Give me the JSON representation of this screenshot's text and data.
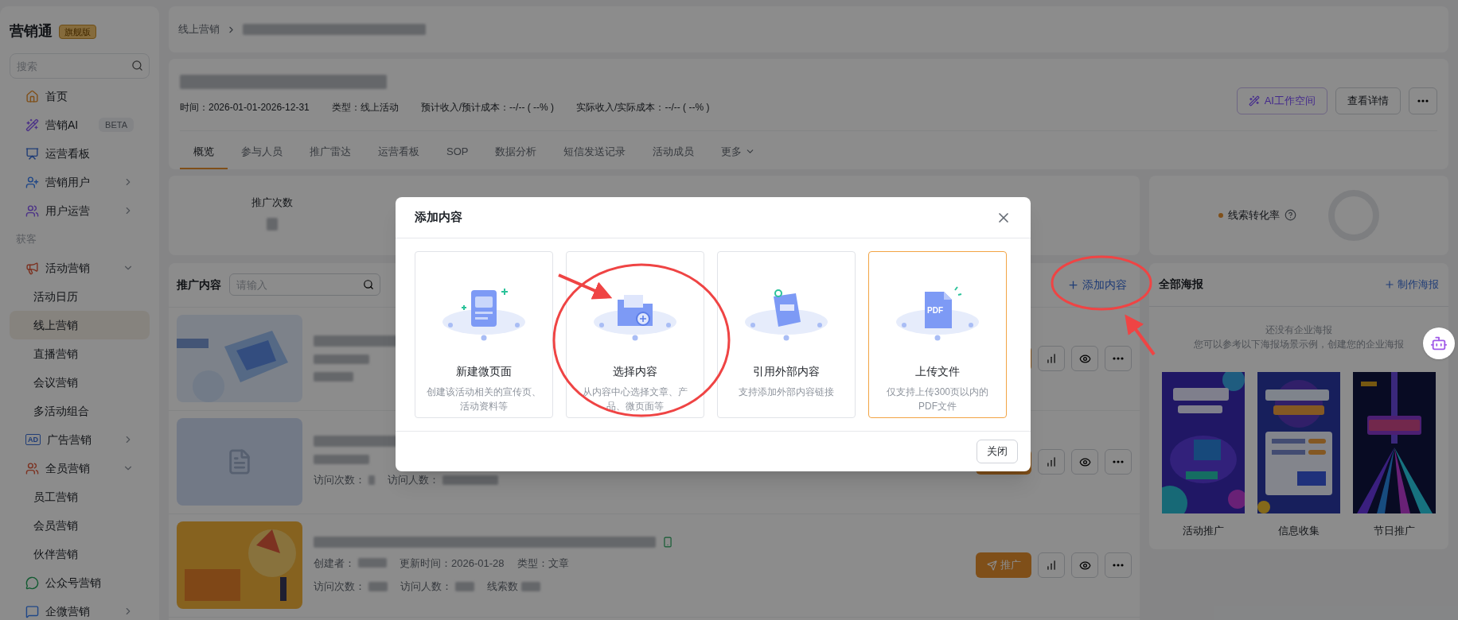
{
  "sidebar": {
    "brand": "营销通",
    "edition": "旗舰版",
    "search": {
      "placeholder": "搜索"
    },
    "items": [
      {
        "kind": "item",
        "label": "首页",
        "selected": false
      },
      {
        "kind": "item",
        "label": "营销AI",
        "badge": "BETA",
        "selected": false
      },
      {
        "kind": "item",
        "label": "运营看板",
        "selected": false
      },
      {
        "kind": "item",
        "label": "营销用户",
        "expanded": false,
        "selected": false
      },
      {
        "kind": "item",
        "label": "用户运营",
        "expanded": false,
        "selected": false
      },
      {
        "kind": "section",
        "label": "获客"
      },
      {
        "kind": "item",
        "label": "活动营销",
        "expanded": true,
        "selected": false,
        "children": [
          {
            "label": "活动日历",
            "selected": false
          },
          {
            "label": "线上营销",
            "selected": true
          },
          {
            "label": "直播营销",
            "selected": false
          },
          {
            "label": "会议营销",
            "selected": false
          },
          {
            "label": "多活动组合",
            "selected": false
          }
        ]
      },
      {
        "kind": "item",
        "icon_text": "AD",
        "label": "广告营销",
        "expanded": false,
        "selected": false
      },
      {
        "kind": "item",
        "label": "全员营销",
        "expanded": true,
        "selected": false,
        "children": [
          {
            "label": "员工营销",
            "selected": false
          },
          {
            "label": "会员营销",
            "selected": false
          },
          {
            "label": "伙伴营销",
            "selected": false
          }
        ]
      },
      {
        "kind": "item",
        "label": "公众号营销",
        "selected": false
      },
      {
        "kind": "item",
        "label": "企微营销",
        "expanded": false,
        "selected": false
      }
    ]
  },
  "breadcrumb": {
    "items": [
      "线上营销"
    ]
  },
  "activity": {
    "meta": [
      "时间：2026-01-01-2026-12-31",
      "类型：线上活动",
      "预计收入/预计成本：--/-- ( --% )",
      "实际收入/实际成本：--/-- ( --% )"
    ],
    "buttons": [
      {
        "kind": "ai",
        "label": "AI工作空间"
      },
      {
        "kind": "plain",
        "label": "查看详情"
      },
      {
        "kind": "more"
      }
    ],
    "tabs": [
      {
        "label": "概览",
        "selected": true
      },
      {
        "label": "参与人员",
        "selected": false
      },
      {
        "label": "推广雷达",
        "selected": false
      },
      {
        "label": "运营看板",
        "selected": false
      },
      {
        "label": "SOP",
        "selected": false
      },
      {
        "label": "数据分析",
        "selected": false
      },
      {
        "label": "短信发送记录",
        "selected": false
      },
      {
        "label": "活动成员",
        "selected": false
      },
      {
        "label": "更多",
        "selected": false,
        "dropdown": true
      }
    ]
  },
  "stats": {
    "items": [
      {
        "label": "推广次数"
      }
    ],
    "conversion": {
      "label": "线索转化率"
    }
  },
  "promo": {
    "title": "推广内容",
    "search": {
      "placeholder": "请输入"
    },
    "add_button": "添加内容",
    "rows": [
      {
        "kind": "picture",
        "fields": []
      },
      {
        "kind": "document",
        "fields": [
          "访问次数：",
          "访问人数："
        ]
      },
      {
        "kind": "picture",
        "mobile": true,
        "fields": [
          "创建者：",
          "更新时间：2026-01-28",
          "类型：文章",
          "访问次数：",
          "访问人数：",
          "线索数"
        ],
        "promote_label": "推广"
      }
    ]
  },
  "posters": {
    "title": "全部海报",
    "action": "制作海报",
    "empty": [
      "还没有企业海报",
      "您可以参考以下海报场景示例，创建您的企业海报"
    ],
    "items": [
      {
        "label": "活动推广",
        "kind": "picture"
      },
      {
        "label": "信息收集",
        "kind": "picture"
      },
      {
        "label": "节日推广",
        "kind": "picture"
      }
    ]
  },
  "modal": {
    "title": "添加内容",
    "options": [
      {
        "kind": "page",
        "title": "新建微页面",
        "desc": "创建该活动相关的宣传页、活动资料等",
        "highlighted": false
      },
      {
        "kind": "folder",
        "title": "选择内容",
        "desc": "从内容中心选择文章、产品、微页面等",
        "highlighted": false
      },
      {
        "kind": "link",
        "title": "引用外部内容",
        "desc": "支持添加外部内容链接",
        "highlighted": false
      },
      {
        "kind": "pdf",
        "icon_text": "PDF",
        "title": "上传文件",
        "desc": "仅支持上传300页以内的PDF文件",
        "highlighted": true
      }
    ],
    "close_button": "关闭"
  }
}
